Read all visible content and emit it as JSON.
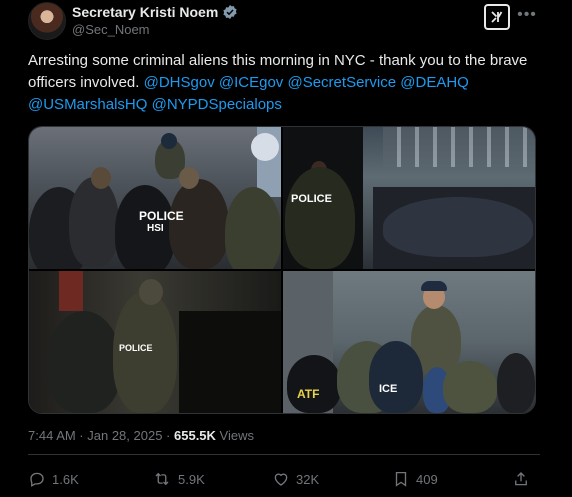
{
  "author": {
    "name": "Secretary Kristi Noem",
    "handle": "@Sec_Noem",
    "verified_color": "#829aab"
  },
  "tweet": {
    "text_plain": "Arresting some criminal aliens this morning in NYC - thank you to the brave officers involved.",
    "mentions": [
      "@DHSgov",
      "@ICEgov",
      "@SecretService",
      "@DEAHQ",
      "@USMarshalsHQ",
      "@NYPDSpecialops"
    ],
    "media_labels": [
      "POLICE",
      "HSI",
      "POLICE",
      "POLICE",
      "ATF",
      "ICE"
    ]
  },
  "meta": {
    "timestamp": "7:44 AM · Jan 28, 2025 ·",
    "views_count": "655.5K",
    "views_label": "Views"
  },
  "actions": {
    "replies": "1.6K",
    "reposts": "5.9K",
    "likes": "32K",
    "bookmarks": "409"
  },
  "colors": {
    "background": "#000000",
    "text": "#e7e9ea",
    "muted": "#71767b",
    "link": "#1d9bf0",
    "border": "#2f3336"
  },
  "icons": [
    "verified-badge-icon",
    "grok-icon",
    "more-icon",
    "reply-icon",
    "repost-icon",
    "like-icon",
    "bookmark-icon",
    "share-icon"
  ]
}
